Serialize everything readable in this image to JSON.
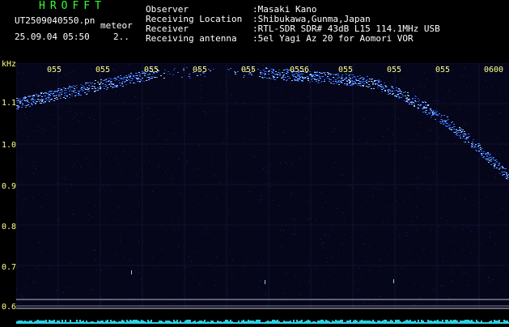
{
  "header": {
    "logo": "HROFFT",
    "filename": "UT2509040550.pn",
    "meteor_label": "meteor",
    "datetime": "25.09.04 05:50",
    "extra": "2.."
  },
  "station": {
    "rows": [
      {
        "key": "Observer",
        "value": ":Masaki Kano"
      },
      {
        "key": "Receiving Location",
        "value": ":Shibukawa,Gunma,Japan"
      },
      {
        "key": "Receiver",
        "value": ":RTL-SDR SDR# 43dB L15 114.1MHz USB"
      },
      {
        "key": "Receiving antenna",
        "value": ":5el Yagi Az 20 for Aomori VOR"
      }
    ]
  },
  "axis": {
    "unit": "kHz",
    "y_labels": [
      "1.1",
      "1.0",
      "0.9",
      "0.8",
      "0.7",
      "0.6"
    ],
    "x_labels": [
      "055",
      "055",
      "055",
      "055",
      "055",
      "0556",
      "055",
      "055",
      "055",
      "0600"
    ]
  },
  "colors": {
    "background": "#000000",
    "plot_bg": "#06061a",
    "text_green": "#33ff33",
    "text_white": "#ffffff",
    "axis_labels": "#ffff88",
    "signal": "#3a7bff"
  }
}
